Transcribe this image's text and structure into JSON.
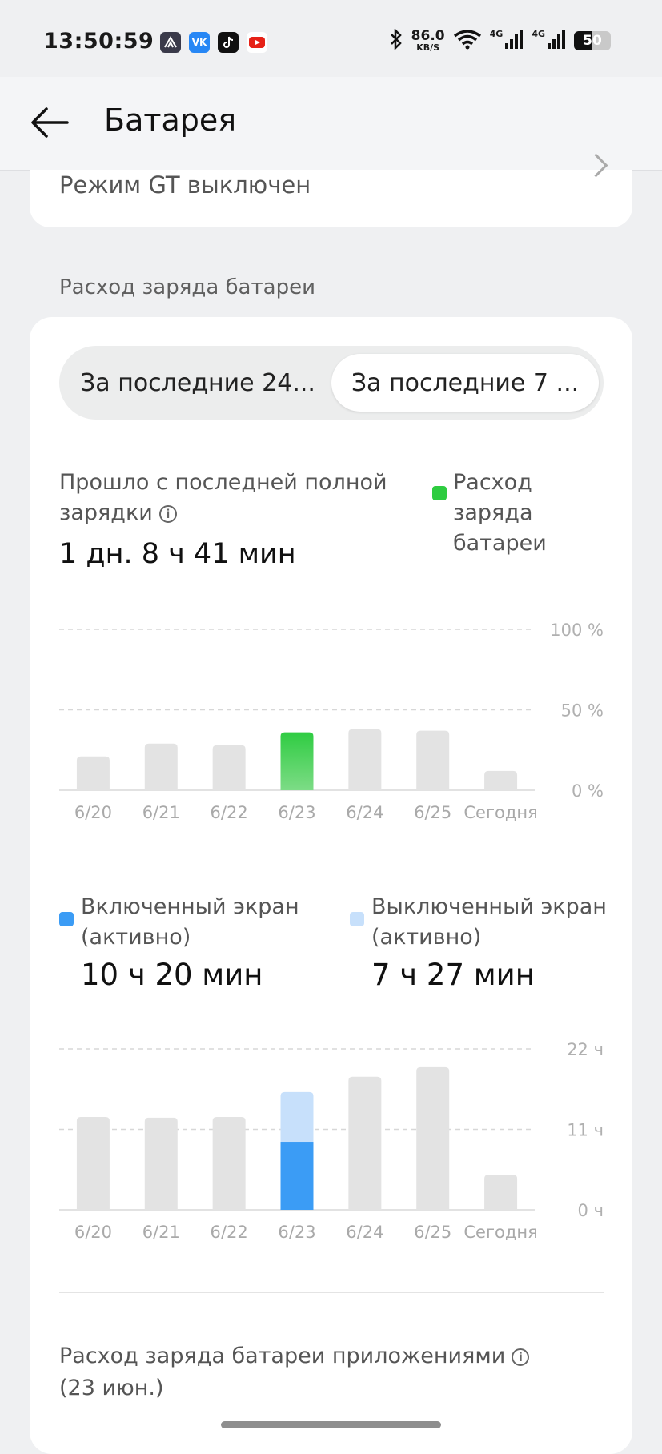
{
  "status_bar": {
    "time": "13:50:59",
    "app_icons": [
      "beeline-icon",
      "vk-icon",
      "tiktok-icon",
      "youtube-icon"
    ],
    "net_speed_value": "86.0",
    "net_speed_unit": "KB/S",
    "signal_labels": [
      "4G",
      "4G"
    ],
    "battery_level": "50"
  },
  "header": {
    "title": "Батарея"
  },
  "gt_mode": {
    "text": "Режим GT выключен"
  },
  "battery_usage": {
    "section_title": "Расход заряда батареи",
    "tabs": [
      {
        "label": "За последние 24...",
        "active": false
      },
      {
        "label": "За последние 7 ...",
        "active": true
      }
    ],
    "since_full_charge_label": "Прошло с последней полной зарядки",
    "since_full_charge_value": "1 дн. 8 ч 41 мин",
    "legend_label": "Расход заряда батареи",
    "legend_color": "#2ecc40"
  },
  "screen_time": {
    "on": {
      "label": "Включенный экран (активно)",
      "value": "10 ч 20 мин",
      "color": "#3b9cf5"
    },
    "off": {
      "label": "Выключенный экран (активно)",
      "value": "7 ч 27 мин",
      "color": "#c7e0fb"
    }
  },
  "chart_data": [
    {
      "type": "bar",
      "categories": [
        "6/20",
        "6/21",
        "6/22",
        "6/23",
        "6/24",
        "6/25",
        "Сегодня"
      ],
      "values": [
        21,
        29,
        28,
        36,
        38,
        37,
        12
      ],
      "selected_index": 3,
      "y_ticks": [
        "100 %",
        "50 %",
        "0 %"
      ],
      "ylim": [
        0,
        100
      ],
      "grid": true,
      "colors": {
        "default": "#e3e3e3",
        "selected": "#2ecc40"
      }
    },
    {
      "type": "bar",
      "stacked": true,
      "categories": [
        "6/20",
        "6/21",
        "6/22",
        "6/23",
        "6/24",
        "6/25",
        "Сегодня"
      ],
      "values": [
        12.7,
        12.6,
        12.7,
        16.1,
        18.2,
        19.5,
        4.8
      ],
      "selected_index": 3,
      "series": [
        {
          "name": "Включенный экран (активно)",
          "values": [
            null,
            null,
            null,
            9.3,
            null,
            null,
            null
          ]
        },
        {
          "name": "Выключенный экран (активно)",
          "values": [
            null,
            null,
            null,
            6.8,
            null,
            null,
            null
          ]
        }
      ],
      "y_ticks": [
        "22 ч",
        "11 ч",
        "0 ч"
      ],
      "ylim": [
        0,
        22
      ],
      "grid": true,
      "colors": {
        "default": "#e3e3e3",
        "on": "#3b9cf5",
        "off": "#c7e0fb"
      }
    }
  ],
  "apps_usage": {
    "title": "Расход заряда батареи приложениями",
    "date": "(23 июн.)"
  }
}
